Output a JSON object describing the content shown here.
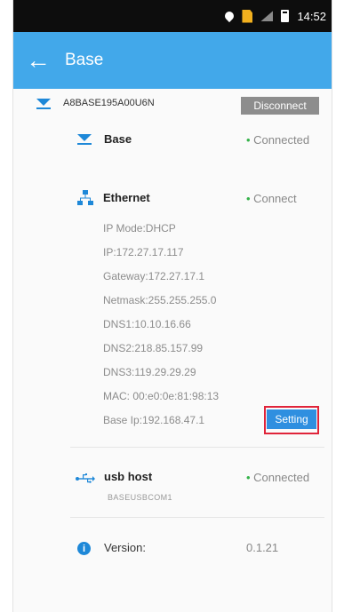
{
  "statusbar": {
    "time": "14:52"
  },
  "appbar": {
    "back_icon": "←",
    "title": "Base"
  },
  "device": {
    "id": "A8BASE195A00U6N",
    "disconnect_label": "Disconnect"
  },
  "base": {
    "label": "Base",
    "status": "Connected"
  },
  "ethernet": {
    "label": "Ethernet",
    "status": "Connect",
    "details": [
      "IP Mode:DHCP",
      "IP:172.27.17.117",
      "Gateway:172.27.17.1",
      "Netmask:255.255.255.0",
      "DNS1:10.10.16.66",
      "DNS2:218.85.157.99",
      "DNS3:119.29.29.29",
      "MAC: 00:e0:0e:81:98:13",
      "Base Ip:192.168.47.1"
    ],
    "setting_label": "Setting"
  },
  "usb": {
    "label": "usb host",
    "status": "Connected",
    "sub": "BASEUSBCOM1"
  },
  "version": {
    "label": "Version:",
    "value": "0.1.21"
  },
  "colors": {
    "accent": "#42a8ea",
    "status_dot": "#35b24a",
    "highlight": "#e0243a"
  }
}
